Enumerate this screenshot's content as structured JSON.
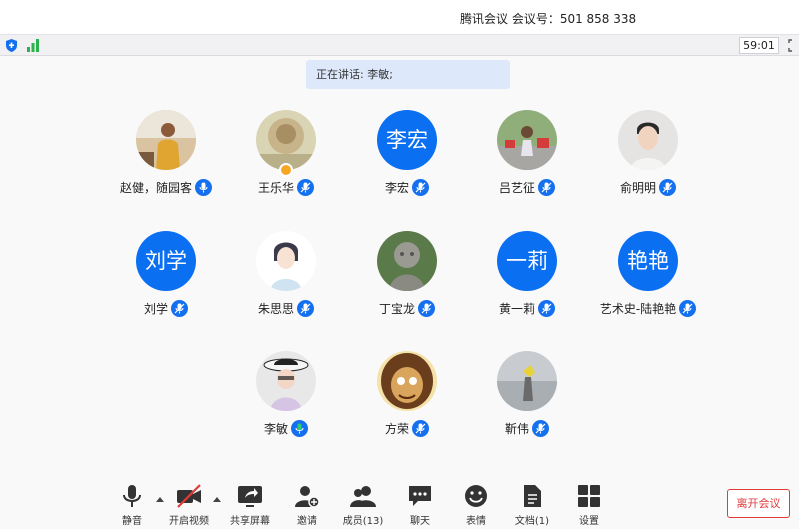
{
  "window": {
    "title": "腾讯会议 会议号：501 858 338"
  },
  "status": {
    "timer": "59:01"
  },
  "banner": {
    "text": "正在讲话: 李敏;"
  },
  "participants": [
    {
      "name": "赵健，随园客",
      "avatar": "photo-avatar-zhao"
    },
    {
      "name": "王乐华",
      "avatar": "photo-avatar-wang",
      "host": true
    },
    {
      "name": "李宏",
      "avatar_text": "李宏"
    },
    {
      "name": "吕艺征",
      "avatar": "photo-avatar-lv"
    },
    {
      "name": "俞明明",
      "avatar": "photo-avatar-yu"
    },
    {
      "name": "刘学",
      "avatar_text": "刘学"
    },
    {
      "name": "朱思思",
      "avatar": "photo-avatar-zhu"
    },
    {
      "name": "丁宝龙",
      "avatar": "photo-avatar-ding"
    },
    {
      "name": "黄一莉",
      "avatar_text": "一莉"
    },
    {
      "name": "艺术史-陆艳艳",
      "avatar_text": "艳艳"
    },
    {
      "name": "李敏",
      "avatar": "photo-avatar-limin",
      "speaking": true
    },
    {
      "name": "方荣",
      "avatar": "photo-avatar-fang"
    },
    {
      "name": "靳伟",
      "avatar": "photo-avatar-jin"
    }
  ],
  "toolbar": {
    "mute": "静音",
    "video": "开启视频",
    "share": "共享屏幕",
    "invite": "邀请",
    "members": "成员(13)",
    "chat": "聊天",
    "emoji": "表情",
    "docs": "文档(1)",
    "settings": "设置",
    "leave": "离开会议"
  },
  "colors": {
    "accent": "#0b6ff2",
    "mic": "#1570ef",
    "leave": "#e23b3b",
    "banner": "#dde9fa"
  }
}
